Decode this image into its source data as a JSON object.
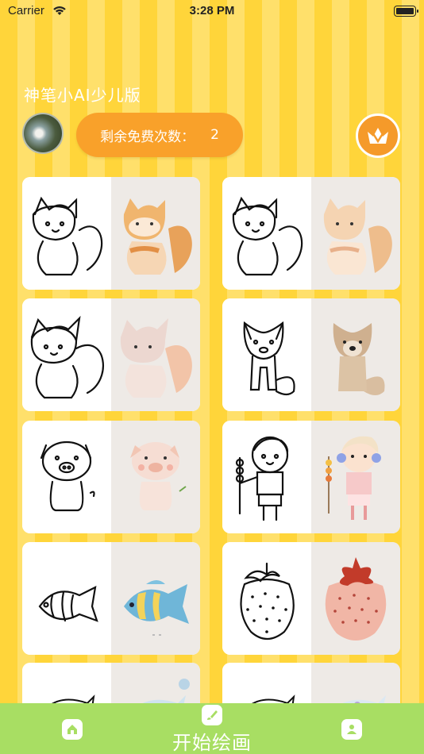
{
  "status_bar": {
    "carrier": "Carrier",
    "time": "3:28 PM"
  },
  "header": {
    "app_title": "神笔小AI少儿版"
  },
  "credits": {
    "label": "剩余免费次数：",
    "count": "2"
  },
  "gallery": [
    {
      "subject": "squirrel",
      "palette": "orange"
    },
    {
      "subject": "squirrel",
      "palette": "peach"
    },
    {
      "subject": "squirrel",
      "palette": "pink"
    },
    {
      "subject": "dog",
      "palette": "tan"
    },
    {
      "subject": "pig",
      "palette": "pink"
    },
    {
      "subject": "boy",
      "palette": "pastel"
    },
    {
      "subject": "fish",
      "palette": "blue-yellow"
    },
    {
      "subject": "strawberry",
      "palette": "red"
    },
    {
      "subject": "dolphin",
      "palette": "blue"
    },
    {
      "subject": "dolphin",
      "palette": "blue"
    }
  ],
  "tab_bar": {
    "draw_label": "开始绘画",
    "icons": [
      "home-icon",
      "brush-icon",
      "user-icon"
    ]
  }
}
